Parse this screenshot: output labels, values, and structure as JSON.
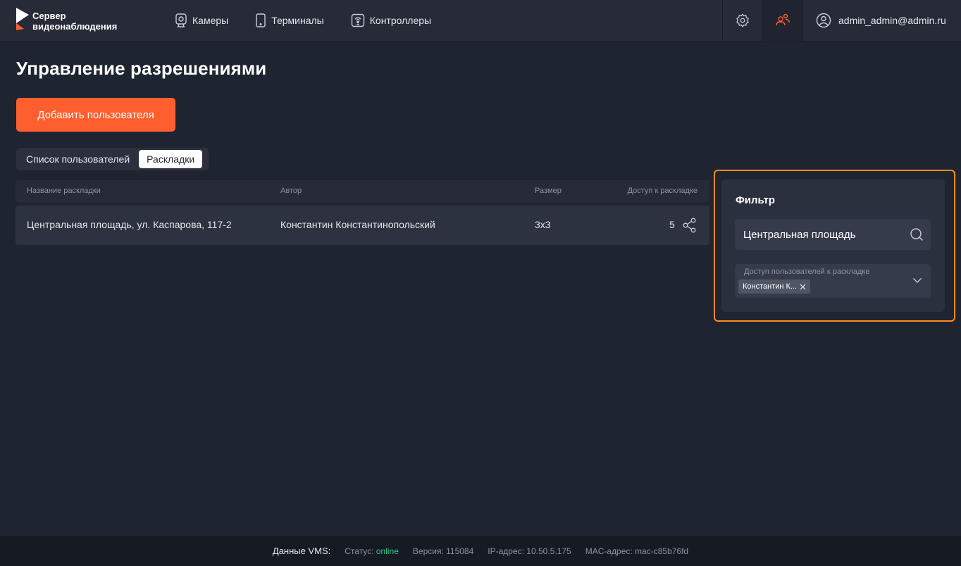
{
  "app": {
    "logo_line1": "Сервер",
    "logo_line2": "видеонаблюдения"
  },
  "nav": [
    {
      "label": "Камеры",
      "icon": "camera-icon"
    },
    {
      "label": "Терминалы",
      "icon": "tablet-icon"
    },
    {
      "label": "Контроллеры",
      "icon": "controller-icon"
    }
  ],
  "header": {
    "settings_icon": "gear-icon",
    "users_icon": "users-icon",
    "user_email": "admin_admin@admin.ru"
  },
  "page": {
    "title": "Управление разрешениями",
    "add_button": "Добавить пользователя"
  },
  "tabs": [
    {
      "label": "Список пользователей",
      "active": false
    },
    {
      "label": "Раскладки",
      "active": true
    }
  ],
  "table": {
    "columns": [
      "Название раскладки",
      "Автор",
      "Размер",
      "Доступ к раскладке"
    ],
    "rows": [
      {
        "name": "Центральная площадь, ул. Каспарова, 117-2",
        "author": "Константин Константинопольский",
        "size": "3x3",
        "access": "5"
      }
    ]
  },
  "filter": {
    "title": "Фильтр",
    "search_value": "Центральная площадь",
    "access_label": "Доступ пользователей к раскладке",
    "access_chips": [
      "Константин К..."
    ]
  },
  "footer": {
    "label": "Данные VMS:",
    "status_label": "Статус: ",
    "status_value": "online",
    "version": "Версия: 115084",
    "ip": "IP-адрес: 10.50.5.175",
    "mac": "MAC-адрес: mac-c85b76fd"
  },
  "colors": {
    "accent": "#ff5f2e",
    "highlight": "#ff8c1a",
    "online": "#2fc98b",
    "background": "#1f2431"
  }
}
